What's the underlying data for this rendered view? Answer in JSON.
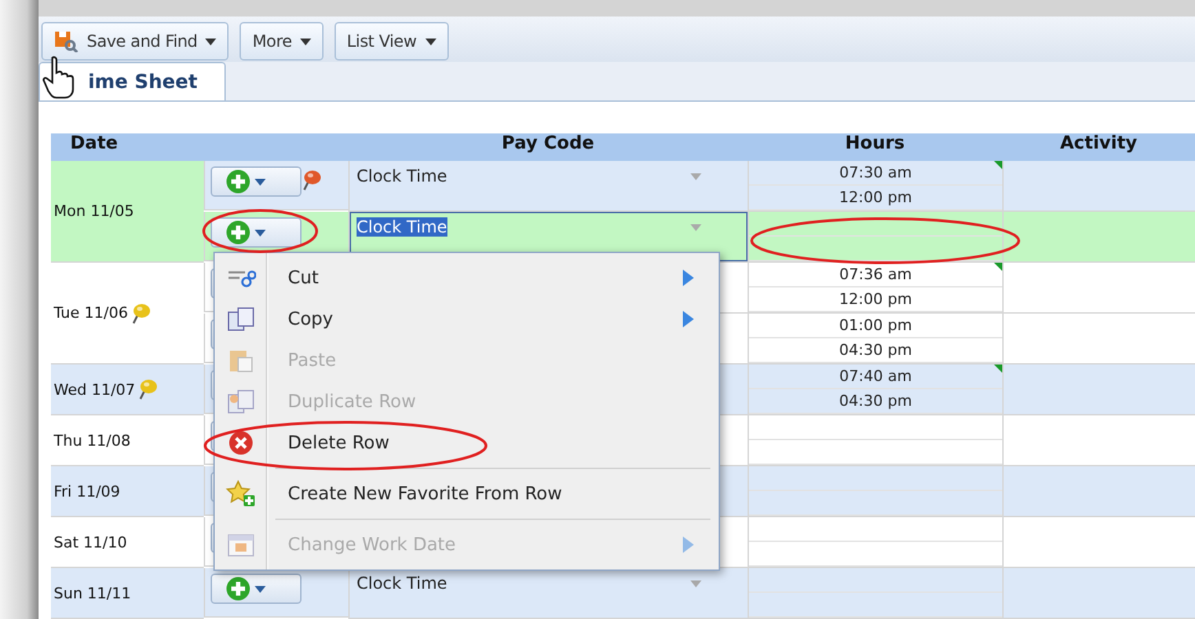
{
  "toolbar": {
    "buttons": [
      {
        "label": "Save and Find",
        "icon": true
      },
      {
        "label": "More"
      },
      {
        "label": "List View"
      }
    ]
  },
  "tabs": [
    {
      "label": "ime Sheet",
      "selected": true
    }
  ],
  "table": {
    "columns": [
      "Date",
      "Pay Code",
      "Hours",
      "Activity"
    ],
    "days": [
      {
        "date": "Mon 11/05",
        "selected": true,
        "entries": [
          {
            "pay_code": "Clock Time",
            "selected": false,
            "pin": true,
            "hours": [
              {
                "time": "07:30 am",
                "flagged": true
              },
              {
                "time": "12:00 pm",
                "flagged": false
              }
            ]
          },
          {
            "pay_code": "Clock Time",
            "selected": true
          }
        ]
      },
      {
        "date": "Tue 11/06",
        "selected": false,
        "pin": true,
        "entries": [
          {
            "selected": false,
            "hours": [
              {
                "time": "07:36 am",
                "flagged": true
              },
              {
                "time": "12:00 pm",
                "flagged": false
              }
            ]
          },
          {
            "selected": false,
            "hours": [
              {
                "time": "01:00 pm",
                "flagged": false
              },
              {
                "time": "04:30 pm",
                "flagged": false
              }
            ]
          }
        ]
      },
      {
        "date": "Wed 11/07",
        "selected": false,
        "pin": true,
        "entries": [
          {
            "selected": false,
            "hours": [
              {
                "time": "07:40 am",
                "flagged": true
              },
              {
                "time": "04:30 pm",
                "flagged": false
              }
            ]
          }
        ]
      },
      {
        "date": "Thu 11/08",
        "selected": false,
        "entries": [
          {
            "selected": false
          }
        ]
      },
      {
        "date": "Fri 11/09",
        "selected": false,
        "entries": [
          {
            "selected": false
          }
        ]
      },
      {
        "date": "Sat 11/10",
        "selected": false,
        "entries": [
          {
            "selected": false
          }
        ]
      },
      {
        "date": "Sun 11/11",
        "selected": false,
        "entries": [
          {
            "pay_code": "Clock Time",
            "selected": false
          }
        ]
      }
    ]
  },
  "context_menu": {
    "items": [
      {
        "kind": "item",
        "label": "Cut",
        "disabled": false,
        "submenu": true
      },
      {
        "kind": "item",
        "label": "Copy",
        "disabled": false,
        "submenu": true
      },
      {
        "kind": "item",
        "label": "Paste",
        "disabled": true,
        "submenu": false
      },
      {
        "kind": "item",
        "label": "Duplicate Row",
        "disabled": true,
        "submenu": false
      },
      {
        "kind": "item",
        "label": "Delete Row",
        "disabled": false,
        "submenu": false
      },
      {
        "kind": "separator"
      },
      {
        "kind": "item",
        "label": "Create New Favorite From Row",
        "disabled": false,
        "submenu": false
      },
      {
        "kind": "separator"
      },
      {
        "kind": "item",
        "label": "Change Work Date",
        "disabled": true,
        "submenu": true
      }
    ]
  }
}
